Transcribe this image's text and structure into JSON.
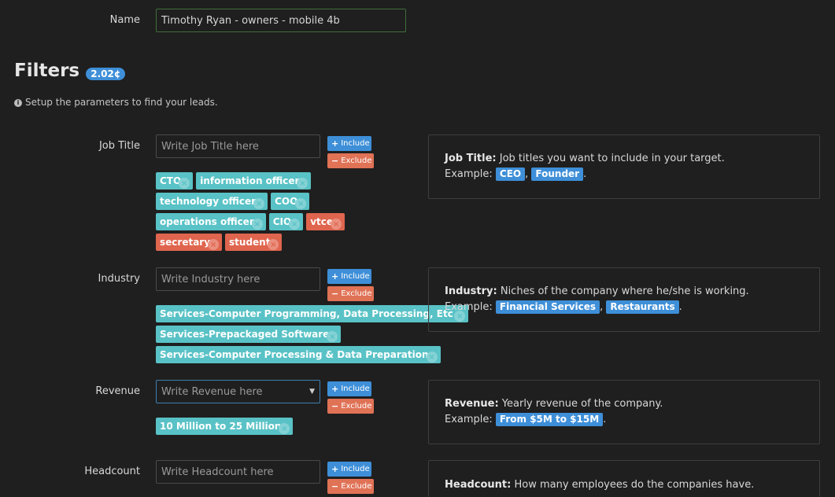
{
  "name_field": {
    "label": "Name",
    "value": "Timothy Ryan - owners - mobile 4b"
  },
  "filters": {
    "title": "Filters",
    "cost_badge": "2.02¢",
    "hint": "Setup the parameters to find your leads."
  },
  "buttons": {
    "include": "Include",
    "exclude": "Exclude"
  },
  "job_title": {
    "label": "Job Title",
    "placeholder": "Write Job Title here",
    "tags": [
      {
        "text": "CTO",
        "type": "include"
      },
      {
        "text": "information officer",
        "type": "include"
      },
      {
        "text": "technology officer",
        "type": "include"
      },
      {
        "text": "COO",
        "type": "include"
      },
      {
        "text": "operations officer",
        "type": "include"
      },
      {
        "text": "CIO",
        "type": "include"
      },
      {
        "text": "vtce",
        "type": "exclude"
      },
      {
        "text": "secretary",
        "type": "exclude"
      },
      {
        "text": "student",
        "type": "exclude"
      }
    ],
    "help_title": "Job Title:",
    "help_text": "Job titles you want to include in your target.",
    "example_label": "Example:",
    "examples": [
      "CEO",
      "Founder"
    ]
  },
  "industry": {
    "label": "Industry",
    "placeholder": "Write Industry here",
    "tags": [
      {
        "text": "Services-Computer Programming, Data Processing, Etc.",
        "type": "include"
      },
      {
        "text": "Services-Prepackaged Software",
        "type": "include"
      },
      {
        "text": "Services-Computer Processing & Data Preparation",
        "type": "include"
      }
    ],
    "help_title": "Industry:",
    "help_text": "Niches of the company where he/she is working.",
    "example_label": "Example:",
    "examples": [
      "Financial Services",
      "Restaurants"
    ]
  },
  "revenue": {
    "label": "Revenue",
    "placeholder": "Write Revenue here",
    "tags": [
      {
        "text": "10 Million to 25 Million",
        "type": "include"
      }
    ],
    "help_title": "Revenue:",
    "help_text": "Yearly revenue of the company.",
    "example_label": "Example:",
    "examples": [
      "From $5M to $15M"
    ]
  },
  "headcount": {
    "label": "Headcount",
    "placeholder": "Write Headcount here",
    "help_title": "Headcount:",
    "help_text": "How many employees do the companies have."
  },
  "colors": {
    "accent": "#3e8fd8",
    "include_tag": "#59c2c6",
    "exclude_tag": "#e0654e",
    "exclude_btn": "#e07256"
  }
}
